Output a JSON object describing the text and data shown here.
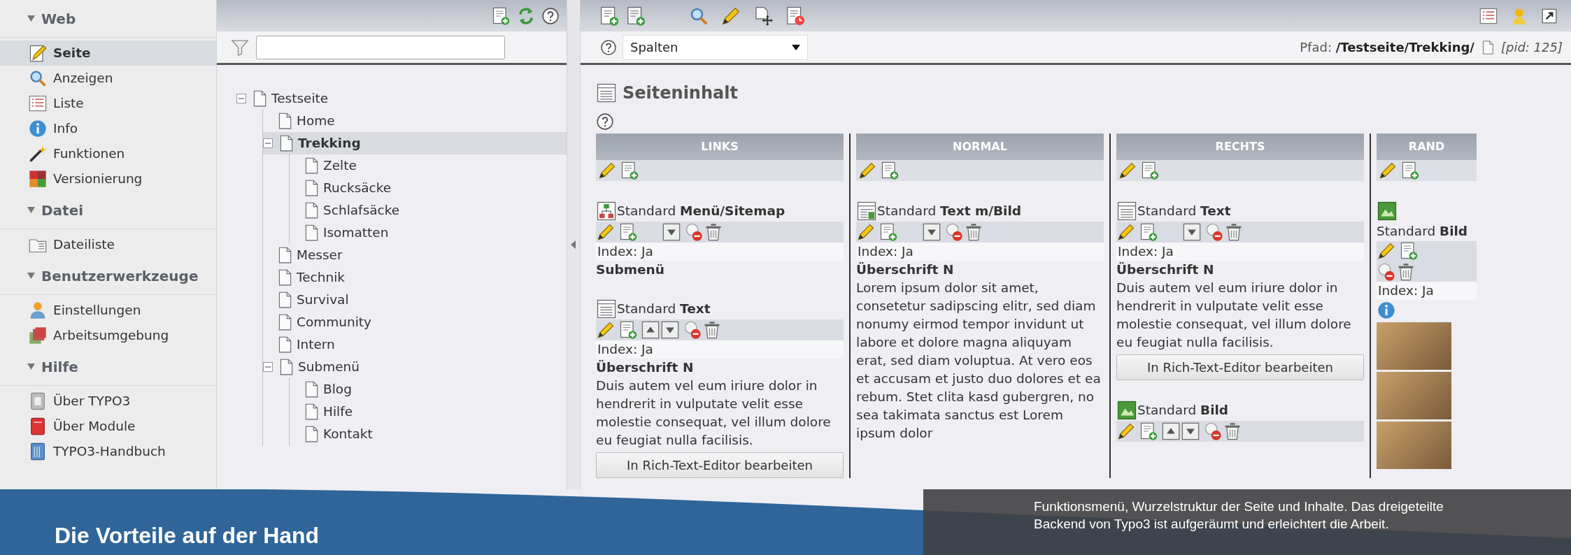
{
  "sidebar": {
    "groups": [
      {
        "label": "Web",
        "expanded": true,
        "items": [
          {
            "label": "Seite",
            "selected": true
          },
          {
            "label": "Anzeigen",
            "selected": false
          },
          {
            "label": "Liste",
            "selected": false
          },
          {
            "label": "Info",
            "selected": false
          },
          {
            "label": "Funktionen",
            "selected": false
          },
          {
            "label": "Versionierung",
            "selected": false
          }
        ]
      },
      {
        "label": "Datei",
        "expanded": true,
        "items": [
          {
            "label": "Dateiliste",
            "selected": false
          }
        ]
      },
      {
        "label": "Benutzerwerkzeuge",
        "expanded": true,
        "items": [
          {
            "label": "Einstellungen",
            "selected": false
          },
          {
            "label": "Arbeitsumgebung",
            "selected": false
          }
        ]
      },
      {
        "label": "Hilfe",
        "expanded": true,
        "items": [
          {
            "label": "Über TYPO3",
            "selected": false
          },
          {
            "label": "Über Module",
            "selected": false
          },
          {
            "label": "TYPO3-Handbuch",
            "selected": false
          }
        ]
      }
    ]
  },
  "page_tree": {
    "nodes": [
      {
        "label": "Testseite",
        "selected": false,
        "expanded": true,
        "children": [
          {
            "label": "Home",
            "selected": false
          },
          {
            "label": "Trekking",
            "selected": true,
            "expanded": true,
            "children": [
              {
                "label": "Zelte",
                "selected": false
              },
              {
                "label": "Rucksäcke",
                "selected": false
              },
              {
                "label": "Schlafsäcke",
                "selected": false
              },
              {
                "label": "Isomatten",
                "selected": false
              }
            ]
          },
          {
            "label": "Messer",
            "selected": false
          },
          {
            "label": "Technik",
            "selected": false
          },
          {
            "label": "Survival",
            "selected": false
          },
          {
            "label": "Community",
            "selected": false
          },
          {
            "label": "Intern",
            "selected": false
          },
          {
            "label": "Submenü",
            "selected": false,
            "expanded": true,
            "children": [
              {
                "label": "Blog",
                "selected": false
              },
              {
                "label": "Hilfe",
                "selected": false
              },
              {
                "label": "Kontakt",
                "selected": false
              }
            ]
          }
        ]
      }
    ]
  },
  "content": {
    "view_select": {
      "value": "Spalten"
    },
    "path": "Pfad: **/Testseite/Trekking/**",
    "pid": "[pid: 125]",
    "heading": "Seiteninhalt",
    "columns": [
      {
        "title": "LINKS",
        "elements": [
          {
            "kind": "menu",
            "title": "Standard **Menü/Sitemap**",
            "can_move_up": false,
            "can_move_down": true,
            "index": "Index: Ja",
            "heading": "Submenü"
          },
          {
            "kind": "text",
            "title": "Standard **Text**",
            "can_move_up": true,
            "can_move_down": true,
            "index": "Index: Ja",
            "heading": "Überschrift N",
            "body": "Duis autem vel eum iriure dolor in hendrerit in vulputate velit esse molestie consequat, vel illum dolore eu feugiat nulla facilisis.",
            "button": "In Rich-Text-Editor bearbeiten"
          }
        ]
      },
      {
        "title": "NORMAL",
        "elements": [
          {
            "kind": "textpic",
            "title": "Standard **Text m/Bild**",
            "can_move_up": false,
            "can_move_down": true,
            "index": "Index: Ja",
            "heading": "Überschrift N",
            "body": "Lorem ipsum dolor sit amet, consetetur sadipscing elitr, sed diam nonumy eirmod tempor invidunt ut labore et dolore magna aliquyam erat, sed diam voluptua. At vero eos et accusam et justo duo dolores et ea rebum. Stet clita kasd gubergren, no sea takimata sanctus est Lorem ipsum dolor"
          }
        ]
      },
      {
        "title": "RECHTS",
        "elements": [
          {
            "kind": "text",
            "title": "Standard **Text**",
            "can_move_up": false,
            "can_move_down": true,
            "index": "Index: Ja",
            "heading": "Überschrift N",
            "body": "Duis autem vel eum iriure dolor in hendrerit in vulputate velit esse molestie consequat, vel illum dolore eu feugiat nulla facilisis.",
            "button": "In Rich-Text-Editor bearbeiten"
          },
          {
            "kind": "image",
            "title": "Standard **Bild**",
            "can_move_up": true,
            "can_move_down": true
          }
        ]
      },
      {
        "title": "RAND",
        "elements": [
          {
            "kind": "image",
            "title": "Standard **Bild**",
            "can_move_up": false,
            "can_move_down": false,
            "index": "Index: Ja",
            "thumbnails": [
              {
                "kind": "photo"
              },
              {
                "kind": "photo"
              },
              {
                "kind": "photo"
              }
            ]
          }
        ]
      }
    ]
  },
  "banner": {
    "heading": "Die Vorteile auf der Hand",
    "caption": "Funktionsmenü, Wurzelstruktur der Seite und Inhalte. Das dreigeteilte Backend von Typo3 ist aufgeräumt und erleichtert die Arbeit."
  }
}
